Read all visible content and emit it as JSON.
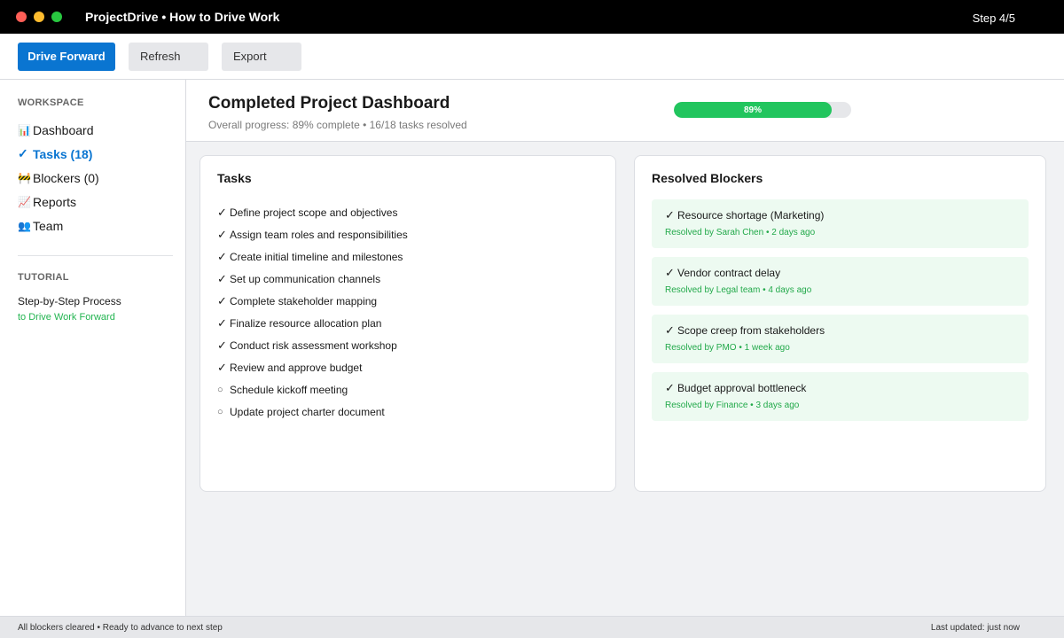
{
  "window": {
    "title": "ProjectDrive • How to Drive Work",
    "step": "Step 4/5"
  },
  "toolbar": {
    "primary_label": "Drive Forward",
    "refresh_label": "Refresh",
    "export_label": "Export"
  },
  "sidebar": {
    "workspace_heading": "WORKSPACE",
    "items": [
      {
        "icon": "📊",
        "icon_name": "bar-chart-icon",
        "label": "Dashboard"
      },
      {
        "icon": "✓",
        "icon_name": "checkmark-icon",
        "label": "Tasks (18)",
        "active": true
      },
      {
        "icon": "🚧",
        "icon_name": "barrier-icon",
        "label": "Blockers (0)"
      },
      {
        "icon": "📈",
        "icon_name": "line-chart-icon",
        "label": "Reports"
      },
      {
        "icon": "👥",
        "icon_name": "people-icon",
        "label": "Team"
      }
    ],
    "tutorial_heading": "TUTORIAL",
    "tutorial_line1": "Step-by-Step Process",
    "tutorial_line2": "to Drive Work Forward"
  },
  "header": {
    "title": "Completed Project Dashboard",
    "subtitle": "Overall progress: 89% complete • 16/18 tasks resolved",
    "progress_value": 89,
    "progress_label": "89%"
  },
  "tasks": {
    "title": "Tasks",
    "items": [
      {
        "done": true,
        "mark": "✓",
        "label": "Define project scope and objectives"
      },
      {
        "done": true,
        "mark": "✓",
        "label": "Assign team roles and responsibilities"
      },
      {
        "done": true,
        "mark": "✓",
        "label": "Create initial timeline and milestones"
      },
      {
        "done": true,
        "mark": "✓",
        "label": "Set up communication channels"
      },
      {
        "done": true,
        "mark": "✓",
        "label": "Complete stakeholder mapping"
      },
      {
        "done": true,
        "mark": "✓",
        "label": "Finalize resource allocation plan"
      },
      {
        "done": true,
        "mark": "✓",
        "label": "Conduct risk assessment workshop"
      },
      {
        "done": true,
        "mark": "✓",
        "label": "Review and approve budget"
      },
      {
        "done": false,
        "mark": "○",
        "label": "Schedule kickoff meeting"
      },
      {
        "done": false,
        "mark": "○",
        "label": "Update project charter document"
      }
    ]
  },
  "blockers": {
    "title": "Resolved Blockers",
    "items": [
      {
        "mark": "✓",
        "title": "Resource shortage (Marketing)",
        "meta": "Resolved by Sarah Chen • 2 days ago"
      },
      {
        "mark": "✓",
        "title": "Vendor contract delay",
        "meta": "Resolved by Legal team • 4 days ago"
      },
      {
        "mark": "✓",
        "title": "Scope creep from stakeholders",
        "meta": "Resolved by PMO • 1 week ago"
      },
      {
        "mark": "✓",
        "title": "Budget approval bottleneck",
        "meta": "Resolved by Finance • 3 days ago"
      }
    ]
  },
  "status": {
    "left": "All blockers cleared • Ready to advance to next step",
    "right": "Last updated: just now"
  },
  "colors": {
    "accent": "#0a75d1",
    "success": "#22c55e",
    "success_light": "#edfaf1"
  }
}
